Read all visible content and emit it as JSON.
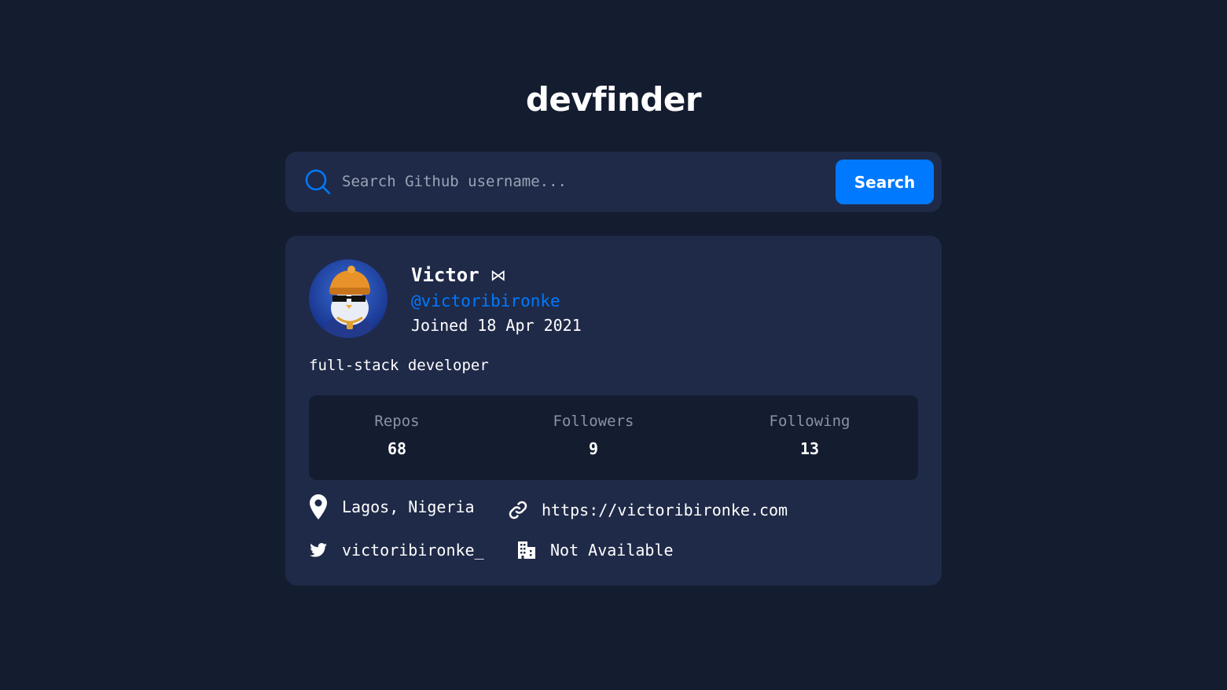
{
  "app": {
    "title": "devfinder"
  },
  "search": {
    "placeholder": "Search Github username...",
    "button_label": "Search"
  },
  "profile": {
    "name": "Victor",
    "name_badge": "⋈",
    "username": "@victoribironke",
    "joined": "Joined 18 Apr 2021",
    "bio": "full-stack developer"
  },
  "stats": [
    {
      "label": "Repos",
      "value": "68"
    },
    {
      "label": "Followers",
      "value": "9"
    },
    {
      "label": "Following",
      "value": "13"
    }
  ],
  "info": {
    "location": "Lagos, Nigeria",
    "website": "https://victoribironke.com",
    "twitter": "victoribironke_",
    "company": "Not Available"
  },
  "colors": {
    "background": "#141c2f",
    "card": "#1f2a48",
    "accent": "#0079ff"
  }
}
